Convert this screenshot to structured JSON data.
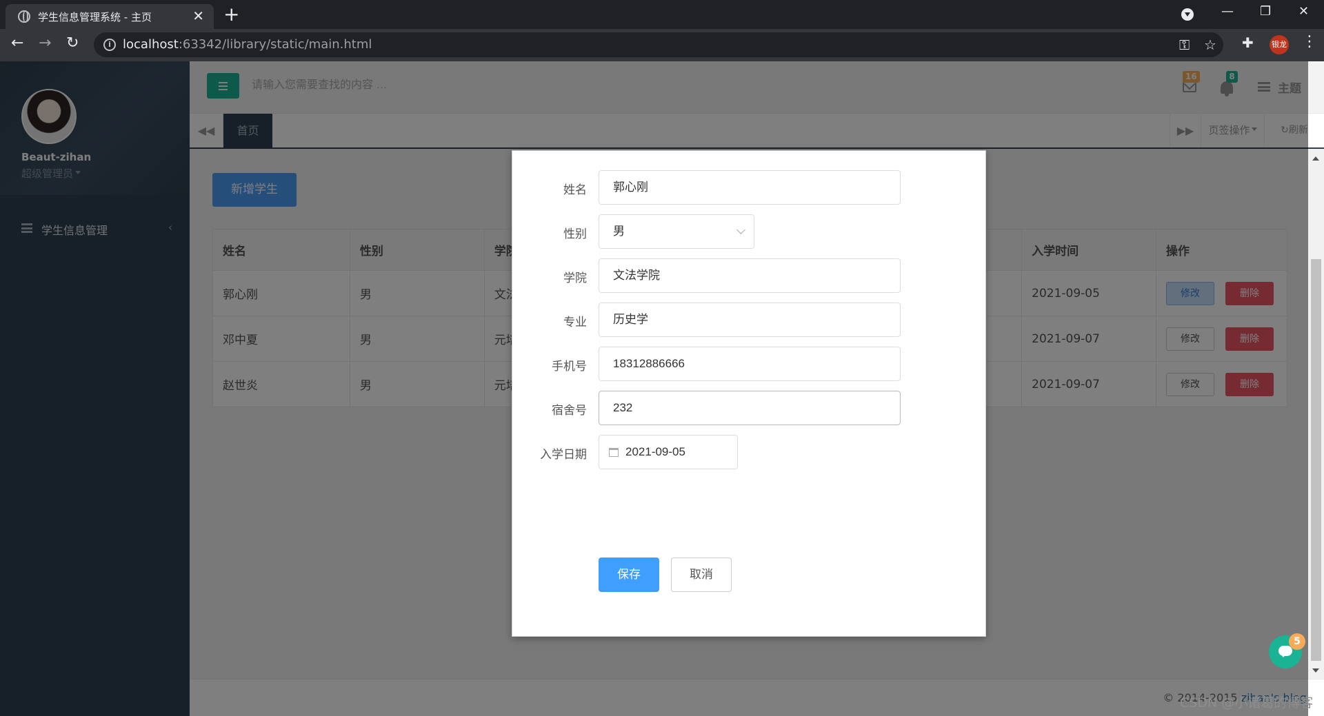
{
  "browser": {
    "tab_title": "学生信息管理系统 - 主页",
    "url_host": "localhost",
    "url_rest": ":63342/library/static/main.html",
    "profile_avatar_text": "银龙"
  },
  "sidebar": {
    "user_name": "Beaut-zihan",
    "user_role": "超级管理员",
    "items": [
      {
        "label": "学生信息管理"
      }
    ]
  },
  "topbar": {
    "search_placeholder": "请输入您需要查找的内容 …",
    "mail_count": "16",
    "notify_count": "8",
    "theme_label": "主题"
  },
  "tabs": {
    "home_label": "首页",
    "ops_label": "页签操作",
    "refresh_label": "刷新"
  },
  "content": {
    "add_button": "新增学生",
    "table": {
      "headers": [
        "姓名",
        "性别",
        "学院",
        "入学时间",
        "操作"
      ],
      "rows": [
        {
          "name": "郭心刚",
          "gender": "男",
          "college": "文法",
          "date": "2021-09-05"
        },
        {
          "name": "邓中夏",
          "gender": "男",
          "college": "元培",
          "date": "2021-09-07"
        },
        {
          "name": "赵世炎",
          "gender": "男",
          "college": "元培",
          "date": "2021-09-07"
        }
      ],
      "edit_label": "修改",
      "delete_label": "删除"
    }
  },
  "modal": {
    "fields": {
      "name_label": "姓名",
      "name_value": "郭心刚",
      "gender_label": "性别",
      "gender_value": "男",
      "college_label": "学院",
      "college_value": "文法学院",
      "major_label": "专业",
      "major_value": "历史学",
      "phone_label": "手机号",
      "phone_value": "18312886666",
      "dorm_label": "宿舍号",
      "dorm_value": "232",
      "date_label": "入学日期",
      "date_value": "2021-09-05"
    },
    "save_label": "保存",
    "cancel_label": "取消"
  },
  "footer": {
    "copyright": "© 2014-2015 ",
    "link": "zihan's blog"
  },
  "watermark": "CSDN @小诸葛的博客",
  "chat_badge": "5",
  "colors": {
    "sidebar": "#2f4050",
    "accent_green": "#1ab394",
    "primary_blue": "#409eff",
    "danger_red": "#ed5565",
    "badge_orange": "#f8ac59"
  }
}
